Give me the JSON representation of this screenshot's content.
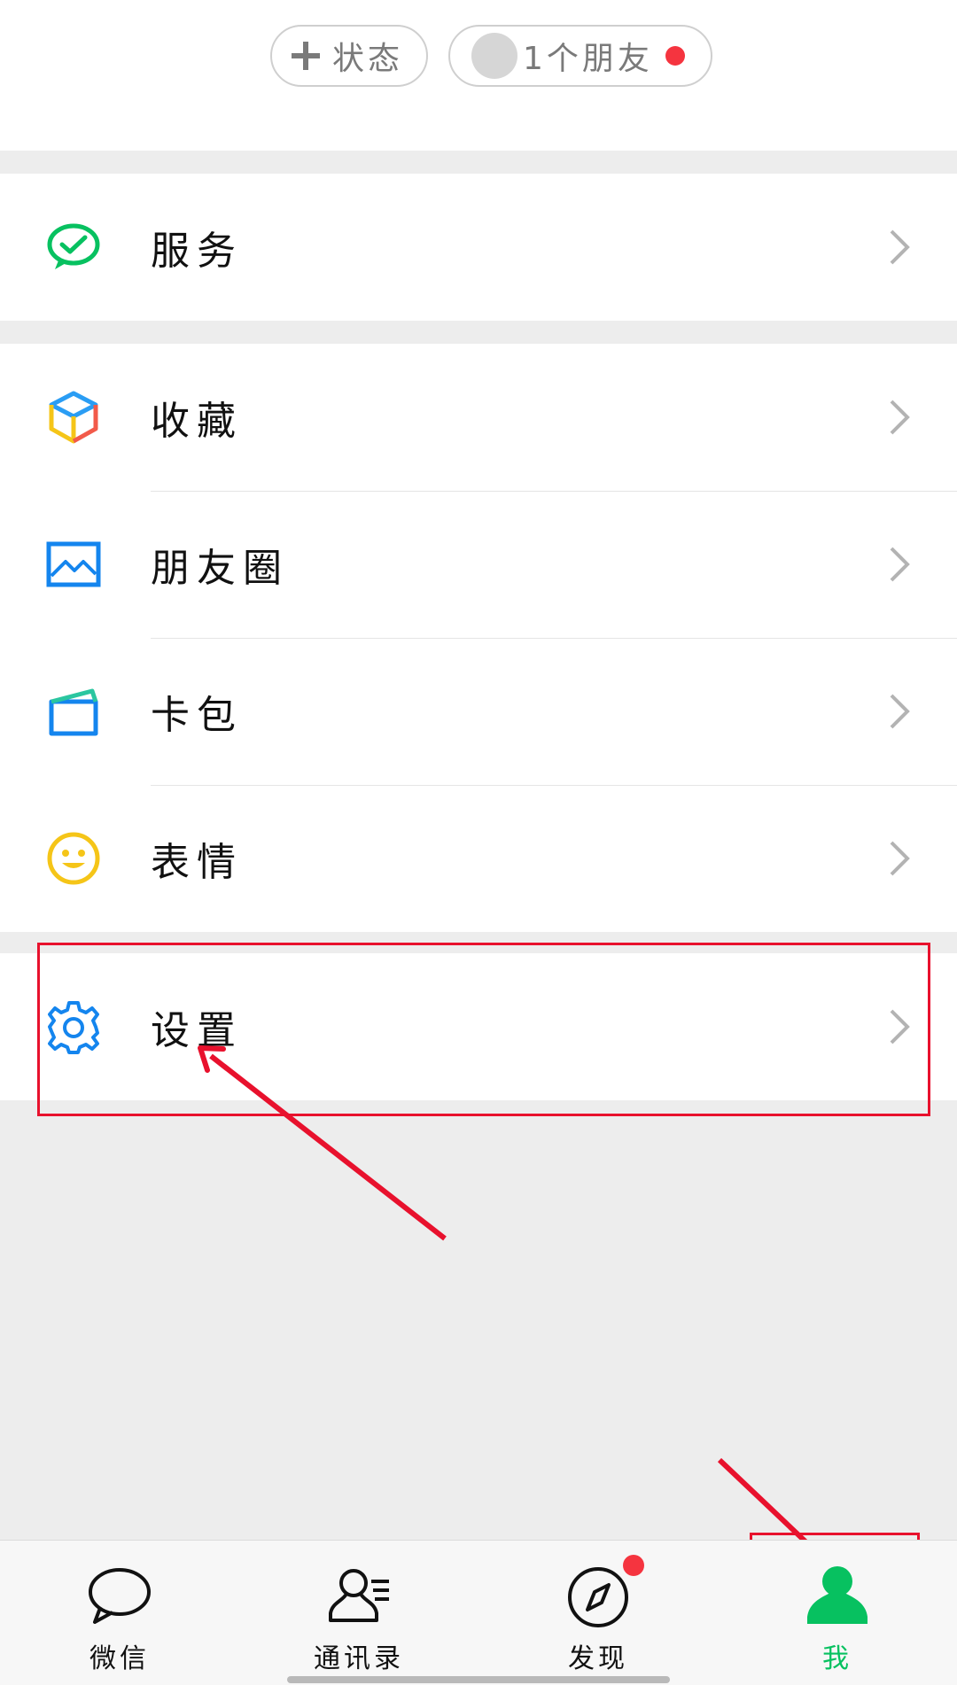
{
  "top": {
    "status_label": "状态",
    "friends_label": "1个朋友"
  },
  "menu": {
    "services": "服务",
    "favorites": "收藏",
    "moments": "朋友圈",
    "cards": "卡包",
    "stickers": "表情",
    "settings": "设置"
  },
  "tabbar": {
    "chats": "微信",
    "contacts": "通讯录",
    "discover": "发现",
    "me": "我"
  },
  "colors": {
    "accent_green": "#07c160",
    "badge_red": "#f5343f",
    "annotation_red": "#e8112d",
    "icon_blue": "#1485ee"
  },
  "icons": {
    "status": "plus-icon",
    "services": "wechat-pay-check-icon",
    "favorites": "cube-icon",
    "moments": "picture-icon",
    "cards": "wallet-icon",
    "stickers": "smiley-icon",
    "settings": "gear-icon",
    "chats": "speech-bubble-icon",
    "contacts": "contacts-icon",
    "discover": "compass-icon",
    "me": "person-icon"
  }
}
